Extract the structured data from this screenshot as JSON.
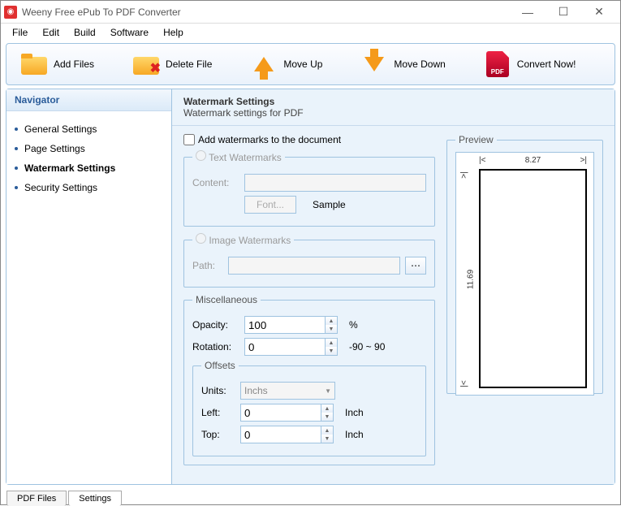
{
  "app": {
    "title": "Weeny Free ePub To PDF Converter"
  },
  "menu": {
    "items": [
      "File",
      "Edit",
      "Build",
      "Software",
      "Help"
    ]
  },
  "toolbar": {
    "add": "Add Files",
    "delete": "Delete File",
    "up": "Move Up",
    "down": "Move Down",
    "convert": "Convert Now!"
  },
  "sidebar": {
    "title": "Navigator",
    "items": [
      "General Settings",
      "Page Settings",
      "Watermark Settings",
      "Security Settings"
    ],
    "active": "Watermark Settings"
  },
  "header": {
    "title": "Watermark Settings",
    "sub": "Watermark settings for PDF"
  },
  "form": {
    "enable_label": "Add watermarks to the document",
    "text_legend": "Text Watermarks",
    "content_label": "Content:",
    "content_value": "",
    "font_btn": "Font...",
    "sample_label": "Sample",
    "image_legend": "Image Watermarks",
    "path_label": "Path:",
    "path_value": "",
    "misc_legend": "Miscellaneous",
    "opacity_label": "Opacity:",
    "opacity_value": "100",
    "opacity_unit": "%",
    "rotation_label": "Rotation:",
    "rotation_value": "0",
    "rotation_range": "-90 ~ 90",
    "offsets_legend": "Offsets",
    "units_label": "Units:",
    "units_value": "Inchs",
    "left_label": "Left:",
    "left_value": "0",
    "top_label": "Top:",
    "top_value": "0",
    "unit": "Inch"
  },
  "preview": {
    "legend": "Preview",
    "width": "8.27",
    "height": "11.69"
  },
  "tabs": {
    "pdf": "PDF Files",
    "settings": "Settings"
  },
  "pdf_label": "PDF"
}
